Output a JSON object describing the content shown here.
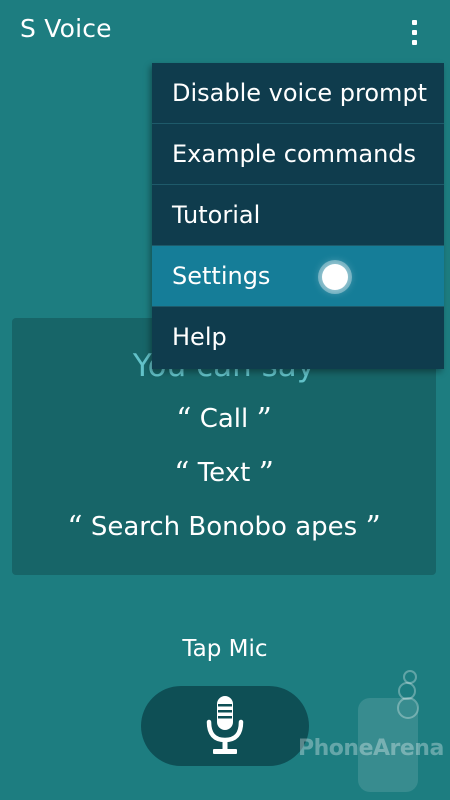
{
  "app": {
    "title": "S Voice"
  },
  "menu": {
    "items": [
      {
        "label": "Disable voice prompt"
      },
      {
        "label": "Example commands"
      },
      {
        "label": "Tutorial"
      },
      {
        "label": "Settings"
      },
      {
        "label": "Help"
      }
    ],
    "active_item": "Settings"
  },
  "suggestions": {
    "title": "You can say",
    "items": [
      {
        "text": "Call"
      },
      {
        "text": "Text"
      },
      {
        "text": "Search Bonobo apes"
      }
    ]
  },
  "mic": {
    "label": "Tap Mic",
    "icon": "microphone-icon"
  },
  "watermark": {
    "text": "PhoneArena"
  },
  "colors": {
    "background": "#1d7d80",
    "menu": "#0f3c4d",
    "menu_active": "#157d98",
    "card": "#176568",
    "card_title": "#62c2c9",
    "mic_button": "#0e4f55"
  }
}
